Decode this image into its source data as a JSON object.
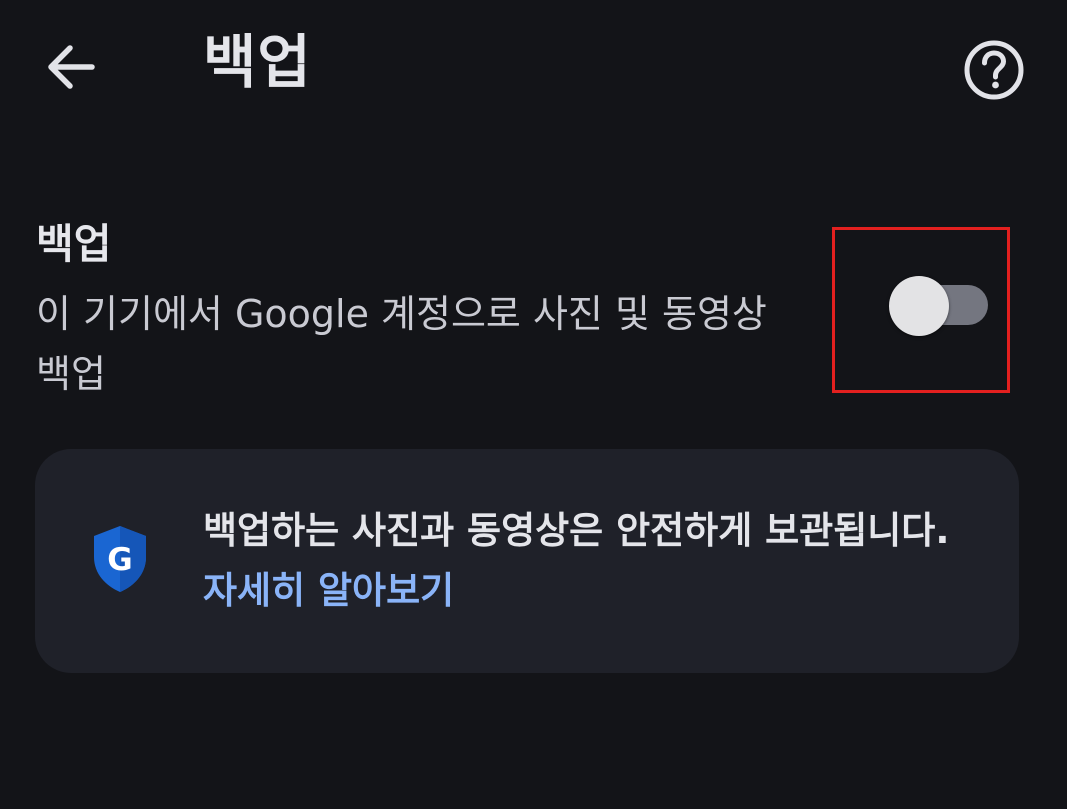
{
  "header": {
    "title": "백업",
    "back_icon": "arrow-left-icon",
    "help_icon": "help-circle-icon"
  },
  "setting": {
    "title": "백업",
    "description": "이 기기에서 Google 계정으로 사진 및 동영상 백업",
    "toggle_state": "off"
  },
  "info_card": {
    "icon": "google-shield-icon",
    "text": "백업하는 사진과 동영상은 안전하게 보관됩니다.",
    "link_label": "자세히 알아보기"
  },
  "colors": {
    "background": "#131418",
    "card": "#1f2129",
    "link": "#8ab4f8",
    "highlight_frame": "#e3201f",
    "shield_blue": "#1a66d2"
  }
}
